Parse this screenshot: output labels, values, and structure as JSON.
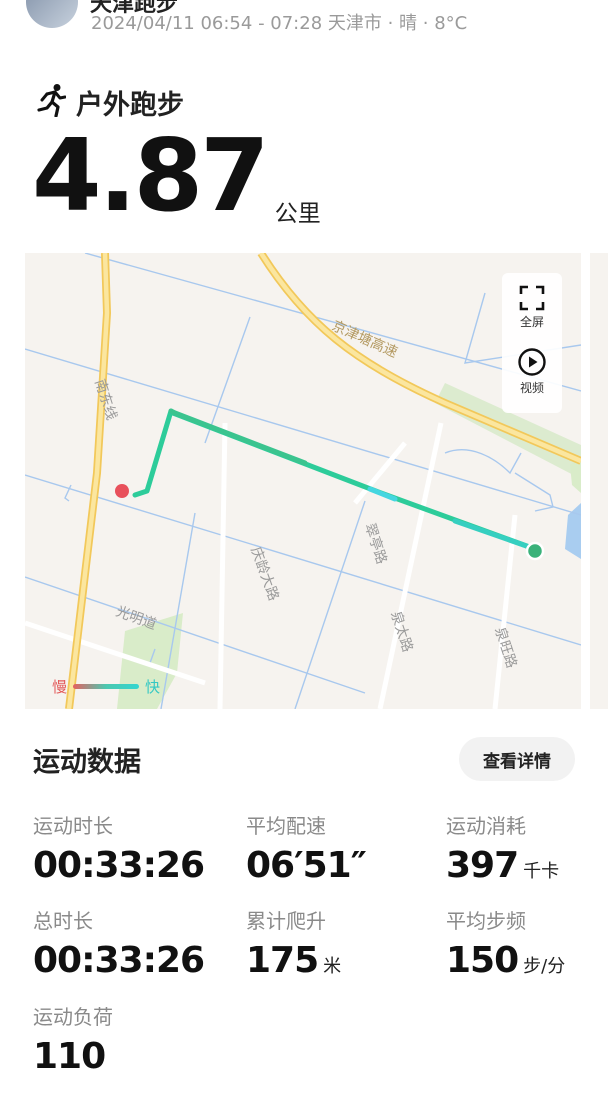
{
  "header": {
    "title": "天津跑步",
    "meta": "2024/04/11 06:54 - 07:28 天津市 · 晴 · 8°C"
  },
  "sport": {
    "type": "户外跑步",
    "icon": "running-person-icon"
  },
  "distance": {
    "value": "4.87",
    "unit": "公里"
  },
  "map": {
    "labels": {
      "highway": "京津塘高速",
      "south_east_line": "南东线",
      "qingling": "庆龄大路",
      "cuiting": "翠亭路",
      "quantai": "泉太路",
      "quanwang": "泉旺路",
      "guangming": "光明道"
    },
    "controls": {
      "fullscreen": "全屏",
      "video": "视频"
    },
    "legend": {
      "slow": "慢",
      "fast": "快"
    },
    "colors": {
      "start": "#3ab27a",
      "end": "#e8505b",
      "route": "#2fcf9e"
    }
  },
  "stats_section": {
    "title": "运动数据",
    "details_button": "查看详情"
  },
  "stats": {
    "duration": {
      "label": "运动时长",
      "value": "00:33:26",
      "unit": ""
    },
    "pace": {
      "label": "平均配速",
      "value": "06′51″",
      "unit": ""
    },
    "calories": {
      "label": "运动消耗",
      "value": "397",
      "unit": "千卡"
    },
    "total_time": {
      "label": "总时长",
      "value": "00:33:26",
      "unit": ""
    },
    "ascent": {
      "label": "累计爬升",
      "value": "175",
      "unit": "米"
    },
    "cadence": {
      "label": "平均步频",
      "value": "150",
      "unit": "步/分"
    },
    "load": {
      "label": "运动负荷",
      "value": "110",
      "unit": ""
    }
  }
}
